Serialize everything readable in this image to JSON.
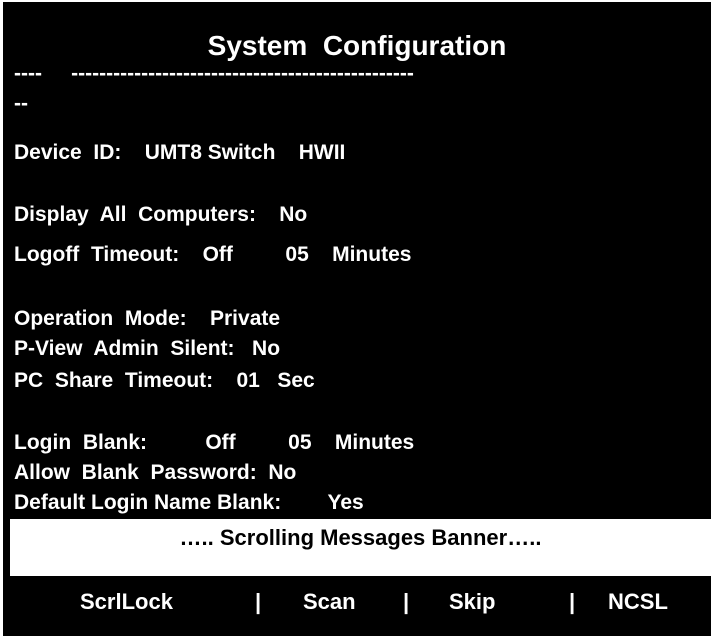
{
  "title": "System  Configuration",
  "dividers": [
    "----     -------------------------------------------------",
    "--"
  ],
  "device_id": "Device  ID:    UMT8 Switch    HWII",
  "display_all_computers": "Display  All  Computers:    No",
  "logoff_timeout": "Logoff  Timeout:    Off         05    Minutes",
  "operation_mode": "Operation  Mode:    Private",
  "pview_admin_silent": "P-View  Admin  Silent:   No",
  "pc_share_timeout": "PC  Share  Timeout:    01   Sec",
  "login_blank": "Login  Blank:          Off         05    Minutes",
  "allow_blank_password": "Allow  Blank  Password:  No",
  "default_login_name_blank": "Default Login Name Blank:        Yes",
  "banner": "….. Scrolling Messages Banner…..",
  "softkeys": {
    "scrllock": "ScrlLock",
    "scan": "Scan",
    "skip": "Skip",
    "ncsl": "NCSL",
    "separator": "|"
  },
  "colors": {
    "background": "#000000",
    "text": "#ffffff",
    "banner_bg": "#ffffff",
    "banner_text": "#000000"
  }
}
